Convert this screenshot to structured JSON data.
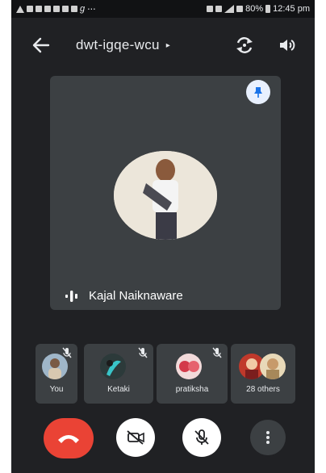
{
  "status_bar": {
    "signal_text": "⋅⋅⋅",
    "battery": "80%",
    "time": "12:45 pm"
  },
  "header": {
    "meeting_code": "dwt-igqe-wcu",
    "caret": "▸"
  },
  "main_tile": {
    "speaker_name": "Kajal Naiknaware"
  },
  "participants": [
    {
      "label": "You",
      "muted": true
    },
    {
      "label": "Ketaki",
      "muted": true
    },
    {
      "label": "pratiksha",
      "muted": true
    },
    {
      "label": "28 others",
      "muted": false
    }
  ],
  "colors": {
    "background": "#202124",
    "tile": "#3c4043",
    "end_call": "#ea4335",
    "pin": "#1a73e8"
  },
  "icons": {
    "back": "arrow-left-icon",
    "switch_camera": "switch-camera-icon",
    "speaker": "speaker-icon",
    "pin": "pin-icon",
    "active_speaker": "audio-wave-icon",
    "end_call": "phone-hangup-icon",
    "camera_off": "camera-off-icon",
    "mic_off": "mic-off-icon",
    "more": "more-vertical-icon"
  }
}
